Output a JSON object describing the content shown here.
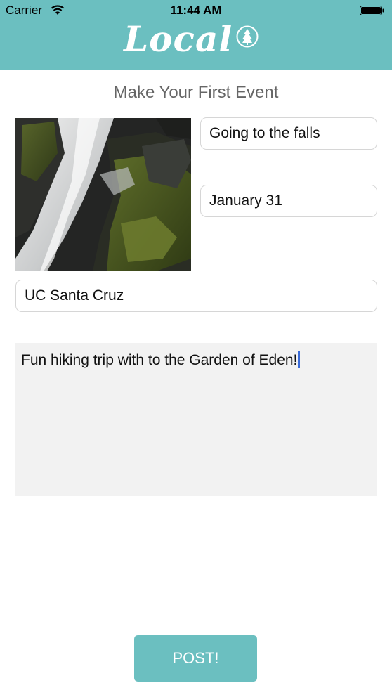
{
  "status_bar": {
    "carrier": "Carrier",
    "time": "11:44 AM"
  },
  "header": {
    "logo_text": "Local",
    "background_color": "#6bbfc0"
  },
  "page_title": "Make Your First Event",
  "event_image": {
    "description_icon": "waterfall-photo"
  },
  "form": {
    "name_value": "Going to the falls",
    "date_value": "January 31",
    "location_value": "UC Santa Cruz",
    "description_value": "Fun hiking trip with to the Garden of Eden!"
  },
  "post_button_label": "POST!",
  "colors": {
    "accent": "#6bbfc0",
    "cursor": "#3a6bd8",
    "text_area_bg": "#f2f2f2"
  }
}
